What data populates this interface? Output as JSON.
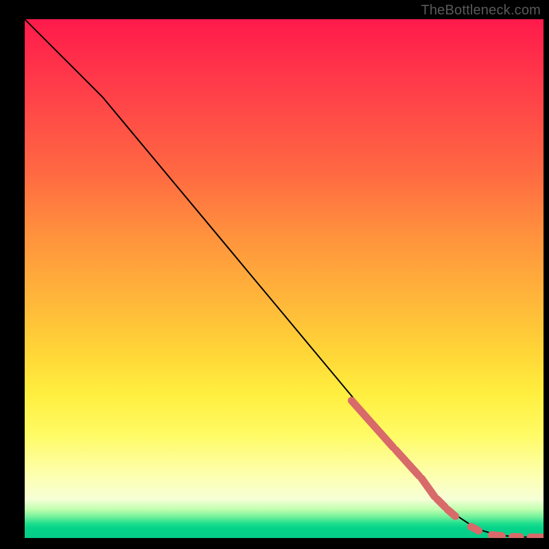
{
  "watermark": "TheBottleneck.com",
  "colors": {
    "background": "#000000",
    "curve": "#000000",
    "marker": "#d86a6a",
    "gradient_top": "#ff1a4b",
    "gradient_mid": "#ffee3e",
    "gradient_bottom": "#04cc88"
  },
  "chart_data": {
    "type": "line",
    "title": "",
    "xlabel": "",
    "ylabel": "",
    "xlim": [
      0,
      100
    ],
    "ylim": [
      0,
      100
    ],
    "grid": false,
    "legend": false,
    "series": [
      {
        "name": "curve",
        "style": "line",
        "x": [
          0,
          3,
          6,
          10,
          15,
          20,
          25,
          30,
          35,
          40,
          45,
          50,
          55,
          60,
          65,
          70,
          75,
          80,
          83,
          86,
          88,
          90,
          92,
          94,
          96,
          98,
          100
        ],
        "y": [
          100,
          97,
          94,
          90,
          85,
          79,
          73,
          67,
          61,
          55,
          49,
          43,
          37,
          31,
          25,
          19,
          13,
          7,
          4.5,
          2.5,
          1.5,
          0.9,
          0.5,
          0.3,
          0.2,
          0.15,
          0.12
        ]
      },
      {
        "name": "highlight-segments",
        "style": "thick-markers",
        "segments": [
          {
            "x": [
              63,
              71
            ],
            "y": [
              26.5,
              17.5
            ]
          },
          {
            "x": [
              71.5,
              76
            ],
            "y": [
              17,
              12
            ]
          },
          {
            "x": [
              76.5,
              79
            ],
            "y": [
              11.5,
              8
            ]
          },
          {
            "x": [
              79.5,
              81
            ],
            "y": [
              7.5,
              6
            ]
          },
          {
            "x": [
              81.5,
              83
            ],
            "y": [
              5.5,
              4.2
            ]
          },
          {
            "x": [
              86,
              87.5
            ],
            "y": [
              2.2,
              1.4
            ]
          },
          {
            "x": [
              90,
              92
            ],
            "y": [
              0.6,
              0.4
            ]
          },
          {
            "x": [
              94,
              95.5
            ],
            "y": [
              0.25,
              0.2
            ]
          },
          {
            "x": [
              97.5,
              100
            ],
            "y": [
              0.15,
              0.12
            ]
          }
        ]
      }
    ]
  }
}
